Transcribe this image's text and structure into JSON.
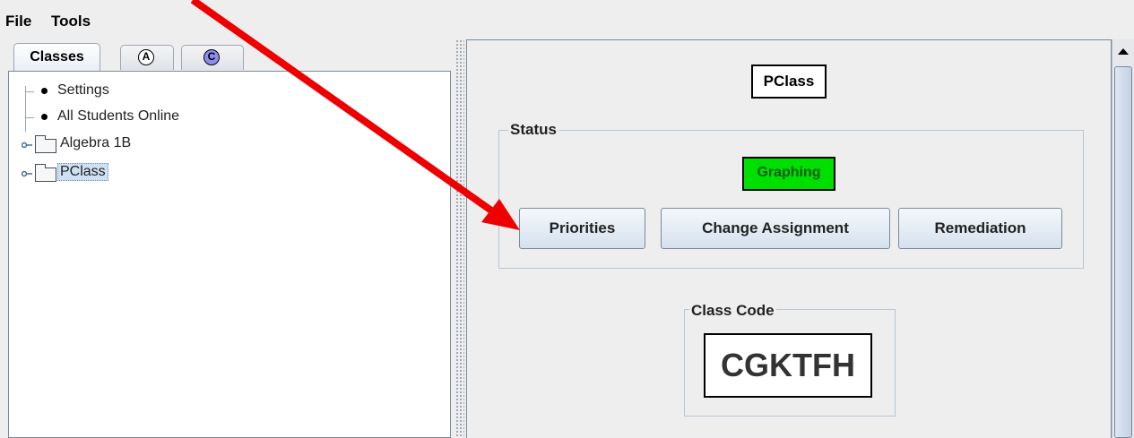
{
  "menu": {
    "file": "File",
    "tools": "Tools"
  },
  "tabs": [
    {
      "label": "Classes"
    },
    {
      "icon_letter": "A"
    },
    {
      "icon_letter": "C"
    }
  ],
  "tree": {
    "items": [
      {
        "label": "Settings"
      },
      {
        "label": "All Students Online"
      },
      {
        "label": "Algebra 1B"
      },
      {
        "label": "PClass"
      }
    ]
  },
  "main": {
    "class_name": "PClass",
    "status_group_title": "Status",
    "status_badge": "Graphing",
    "buttons": {
      "priorities": "Priorities",
      "change_assignment": "Change Assignment",
      "remediation": "Remediation"
    },
    "class_code_group_title": "Class Code",
    "class_code": "CGKTFH"
  },
  "colors": {
    "status_green": "#00e000",
    "annotation_arrow": "#ee0000",
    "tree_selection": "#cfe0f3"
  }
}
